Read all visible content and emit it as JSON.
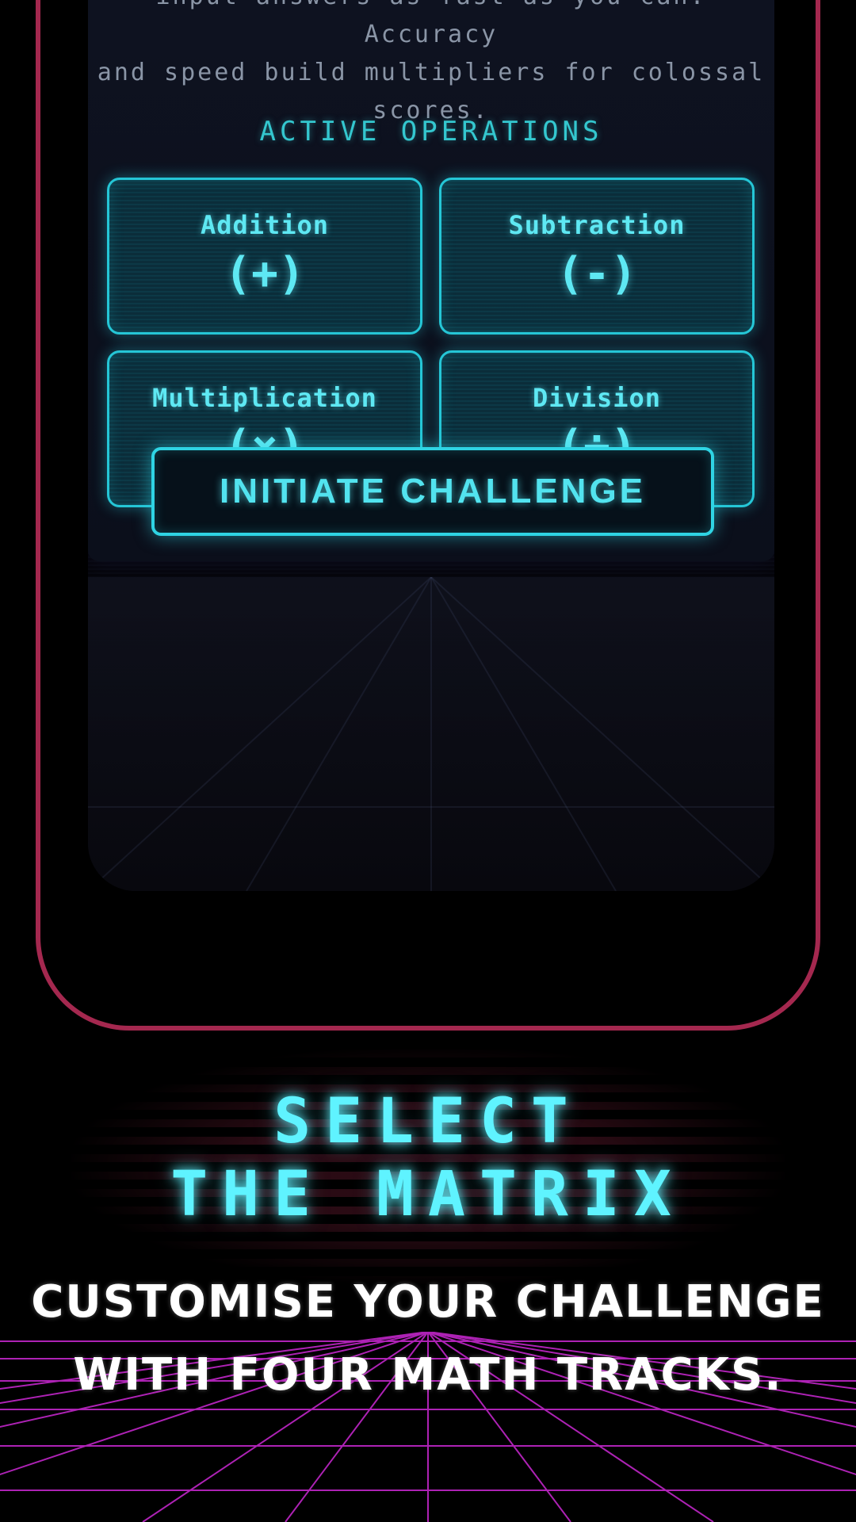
{
  "intro": {
    "line1": "input answers as fast as you can. Accuracy",
    "line2": "and speed build multipliers for colossal",
    "line3": "scores."
  },
  "operations": {
    "title": "ACTIVE OPERATIONS",
    "items": [
      {
        "name": "Addition",
        "symbol": "(+)"
      },
      {
        "name": "Subtraction",
        "symbol": "(-)"
      },
      {
        "name": "Multiplication",
        "symbol": "(×)"
      },
      {
        "name": "Division",
        "symbol": "(÷)"
      }
    ]
  },
  "cta": {
    "label": "INITIATE CHALLENGE"
  },
  "promo": {
    "headline_line1": "SELECT",
    "headline_line2": "THE MATRIX",
    "subline_line1": "CUSTOMISE YOUR CHALLENGE",
    "subline_line2": "WITH FOUR MATH TRACKS."
  },
  "colors": {
    "phone_frame": "#a4284f",
    "accent_cyan": "#25c6d6",
    "grid_magenta": "#c026c8"
  }
}
